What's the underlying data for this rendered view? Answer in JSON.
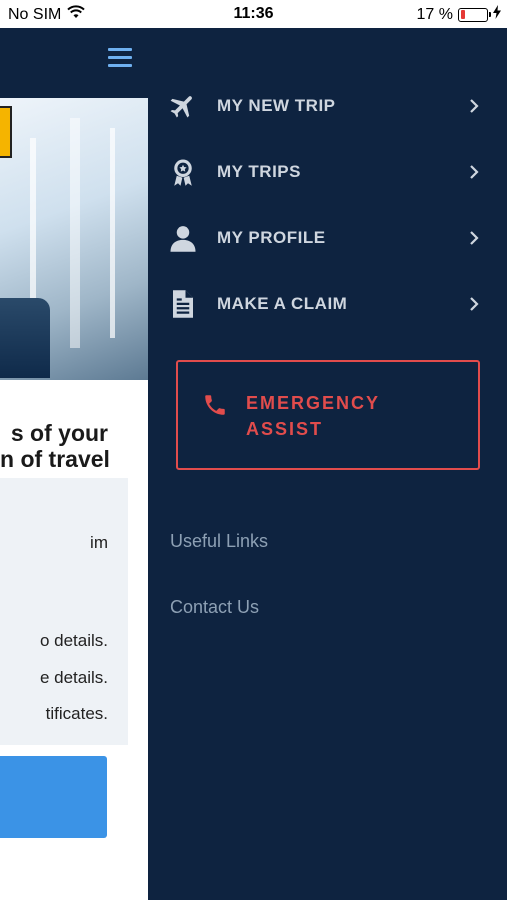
{
  "status_bar": {
    "carrier": "No SIM",
    "time": "11:36",
    "battery_percent_text": "17 %",
    "battery_level": 0.17,
    "battery_color": "#e53935"
  },
  "background_page": {
    "hero_line_1": "s of your",
    "hero_line_2": "n of travel",
    "info_lines": [
      "im",
      "o details.",
      "e details.",
      "tificates."
    ]
  },
  "drawer": {
    "menu": [
      {
        "label": "MY NEW TRIP",
        "icon": "airplane-icon"
      },
      {
        "label": "MY TRIPS",
        "icon": "award-badge-icon"
      },
      {
        "label": "MY PROFILE",
        "icon": "user-icon"
      },
      {
        "label": "MAKE A CLAIM",
        "icon": "document-icon"
      }
    ],
    "emergency": {
      "line_1": "EMERGENCY",
      "line_2": "ASSIST",
      "icon": "phone-icon",
      "color": "#e14c4c"
    },
    "links": [
      "Useful Links",
      "Contact Us"
    ]
  },
  "colors": {
    "drawer_bg": "#0e2340",
    "menu_text": "#cfd6df",
    "link_text": "#8da0b4",
    "accent_blue": "#3b93e6"
  }
}
